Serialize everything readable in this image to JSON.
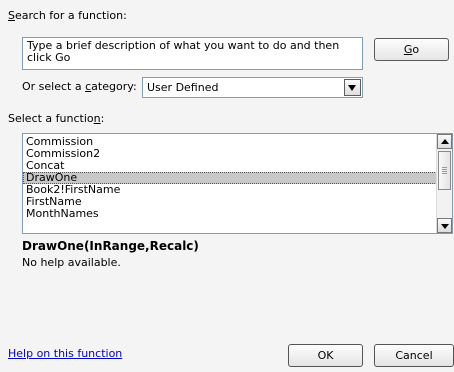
{
  "search": {
    "label_pre": "",
    "label_key": "S",
    "label_post": "earch for a function:",
    "value": "Type a brief description of what you want to do and then click Go",
    "go_pre": "",
    "go_key": "G",
    "go_post": "o"
  },
  "category": {
    "label_pre": "Or select a ",
    "label_key": "c",
    "label_post": "ategory:",
    "selected": "User Defined"
  },
  "function_list": {
    "label_pre": "Select a functio",
    "label_key": "n",
    "label_post": ":",
    "items": [
      "Commission",
      "Commission2",
      "Concat",
      "DrawOne",
      "Book2!FirstName",
      "FirstName",
      "MonthNames"
    ],
    "selected_index": 3
  },
  "details": {
    "signature": "DrawOne(InRange,Recalc)",
    "help": "No help available."
  },
  "footer": {
    "help_link": "Help on this function",
    "ok": "OK",
    "cancel": "Cancel"
  }
}
